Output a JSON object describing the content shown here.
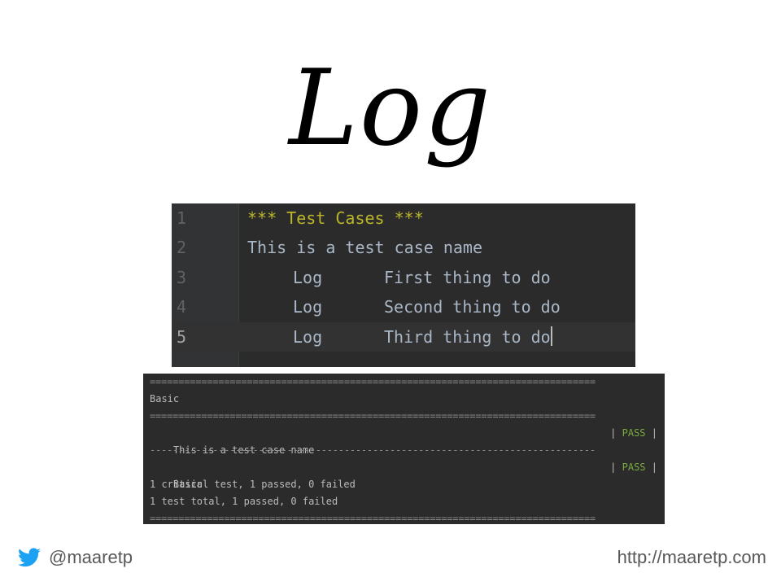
{
  "slide": {
    "title": "Log"
  },
  "editor": {
    "lines": [
      {
        "number": "1",
        "text": "*** Test Cases ***"
      },
      {
        "number": "2",
        "text": "This is a test case name"
      },
      {
        "number": "3",
        "keyword": "Log",
        "argument": "First thing to do"
      },
      {
        "number": "4",
        "keyword": "Log",
        "argument": "Second thing to do"
      },
      {
        "number": "5",
        "keyword": "Log",
        "argument": "Third thing to do"
      }
    ]
  },
  "console": {
    "separator_double": "==============================================================================",
    "separator_single": "------------------------------------------------------------------------------",
    "suite_name": "Basic",
    "test_name": "This is a test case name",
    "test_status": "PASS",
    "suite_status": "PASS",
    "pipe": "|",
    "summary_critical": "1 critical test, 1 passed, 0 failed",
    "summary_total": "1 test total, 1 passed, 0 failed"
  },
  "footer": {
    "twitter_handle": "@maaretp",
    "url": "http://maaretp.com",
    "icon": "twitter-bird-icon",
    "twitter_color": "#1da1f2"
  }
}
